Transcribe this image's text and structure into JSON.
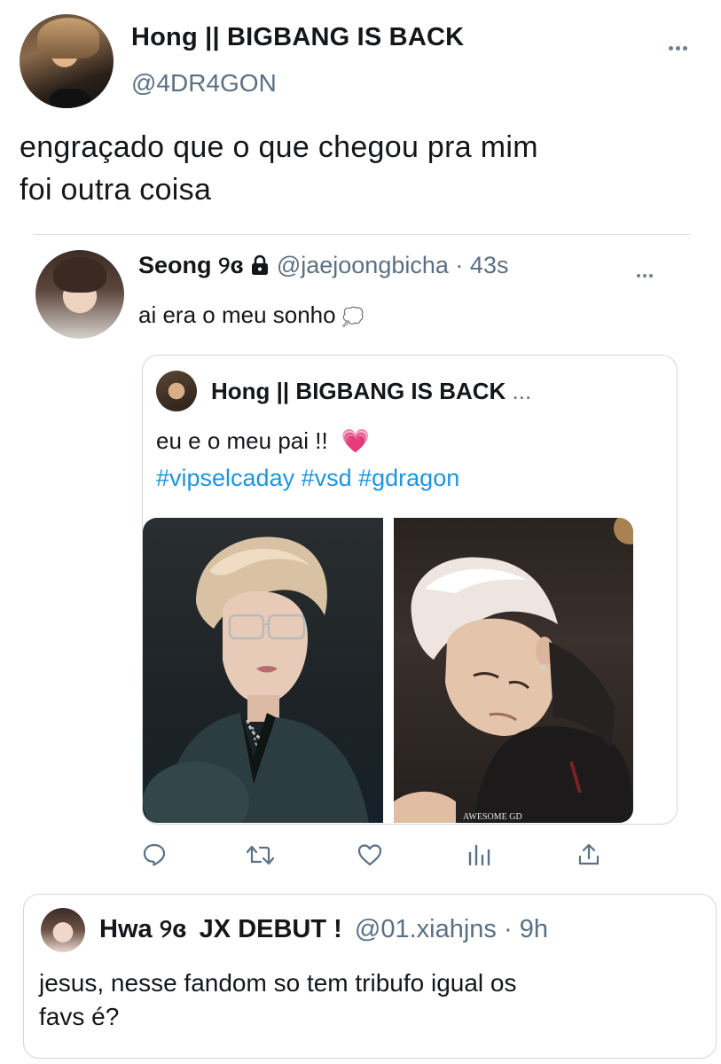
{
  "main_tweet": {
    "display_name": "Hong || BIGBANG IS BACK",
    "handle": "@4DR4GON",
    "text_line1": "engraçado que o que chegou pra mim",
    "text_line2": "foi outra coisa"
  },
  "reply": {
    "display_name": "Seong",
    "name_glyph": "୨ɞ",
    "handle": "@jaejoongbicha",
    "separator": "·",
    "time": "43s",
    "text": "ai era o meu sonho",
    "text_emoji": "💭"
  },
  "quoted": {
    "display_name": "Hong || BIGBANG IS BACK",
    "ellipsis": "...",
    "text": "eu e o meu pai !!",
    "text_emoji": "💗",
    "hashtags": "#vipselcaday #vsd #gdragon",
    "photo_right_watermark": "AWESOME GD"
  },
  "actions": {
    "icons": [
      "reply-icon",
      "retweet-icon",
      "like-icon",
      "analytics-icon",
      "share-icon"
    ]
  },
  "bottom_quote": {
    "display_name": "Hwa",
    "name_glyph": "୨ɞ",
    "name_suffix": "JX DEBUT !",
    "handle": "@01.xiahjns",
    "separator": "·",
    "time": "9h",
    "text_line1": "jesus, nesse fandom so tem tribufo igual os",
    "text_line2": "favs é?"
  },
  "colors": {
    "link": "#1b95e0",
    "secondary_text": "#5b7083",
    "border": "#cfd9de"
  }
}
